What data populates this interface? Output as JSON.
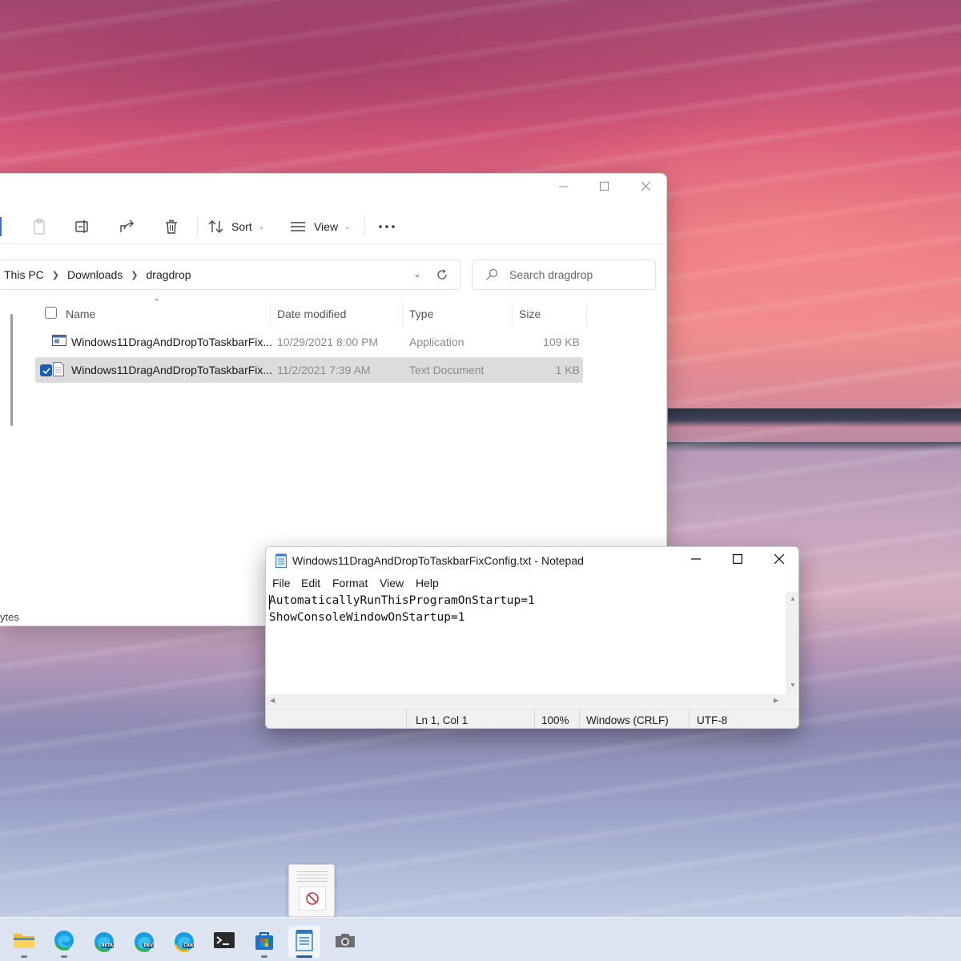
{
  "explorer": {
    "toolbar": {
      "sort_label": "Sort",
      "view_label": "View"
    },
    "breadcrumb": [
      "This PC",
      "Downloads",
      "dragdrop"
    ],
    "search_placeholder": "Search dragdrop",
    "columns": {
      "name": "Name",
      "date": "Date modified",
      "type": "Type",
      "size": "Size"
    },
    "files": [
      {
        "name": "Windows11DragAndDropToTaskbarFix...",
        "date": "10/29/2021 8:00 PM",
        "type": "Application",
        "size": "109 KB",
        "selected": false,
        "icon": "application-icon"
      },
      {
        "name": "Windows11DragAndDropToTaskbarFix...",
        "date": "11/2/2021 7:39 AM",
        "type": "Text Document",
        "size": "1 KB",
        "selected": true,
        "icon": "text-document-icon"
      }
    ],
    "status_text": "ytes"
  },
  "notepad": {
    "title": "Windows11DragAndDropToTaskbarFixConfig.txt - Notepad",
    "menu": [
      "File",
      "Edit",
      "Format",
      "View",
      "Help"
    ],
    "content": [
      "AutomaticallyRunThisProgramOnStartup=1",
      "ShowConsoleWindowOnStartup=1"
    ],
    "status": {
      "position": "Ln 1, Col 1",
      "zoom": "100%",
      "line_ending": "Windows (CRLF)",
      "encoding": "UTF-8"
    }
  },
  "taskbar": {
    "apps": [
      {
        "name": "file-explorer-icon"
      },
      {
        "name": "edge-icon"
      },
      {
        "name": "edge-beta-icon",
        "tag": "BETA"
      },
      {
        "name": "edge-dev-icon",
        "tag": "DEV"
      },
      {
        "name": "edge-canary-icon",
        "tag": "CAN"
      },
      {
        "name": "terminal-icon"
      },
      {
        "name": "microsoft-store-icon"
      },
      {
        "name": "notepad-icon",
        "active": true
      },
      {
        "name": "camera-icon"
      }
    ]
  },
  "colors": {
    "accent": "#1a5fb4",
    "selection": "#dcdcdc"
  }
}
